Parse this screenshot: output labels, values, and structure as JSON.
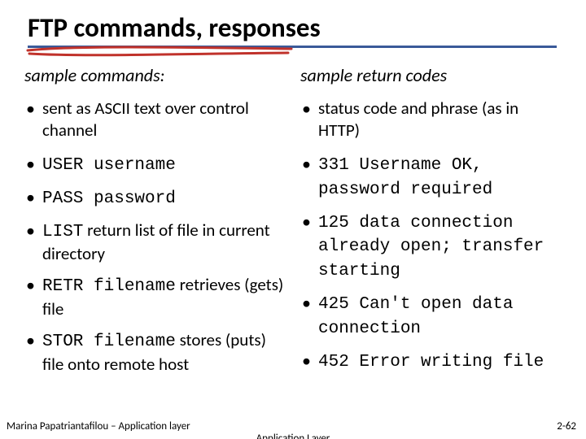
{
  "title": "FTP commands, responses",
  "left": {
    "heading": "sample commands:",
    "items": [
      {
        "plain_pre": "sent as ASCII text over control channel",
        "mono": "",
        "plain_post": ""
      },
      {
        "plain_pre": "",
        "mono": "USER username",
        "plain_post": ""
      },
      {
        "plain_pre": "",
        "mono": "PASS password",
        "plain_post": ""
      },
      {
        "plain_pre": "",
        "mono": "LIST",
        "plain_post": " return list of file in current directory"
      },
      {
        "plain_pre": "",
        "mono": "RETR filename",
        "plain_post": " retrieves (gets) file"
      },
      {
        "plain_pre": "",
        "mono": "STOR filename",
        "plain_post": " stores (puts) file onto remote host"
      }
    ]
  },
  "right": {
    "heading": "sample return codes",
    "items": [
      {
        "plain_pre": "status code and phrase (as in HTTP)",
        "mono": "",
        "plain_post": ""
      },
      {
        "plain_pre": "",
        "mono": "331 Username OK, password required",
        "plain_post": ""
      },
      {
        "plain_pre": "",
        "mono": "125 data connection already open; transfer starting",
        "plain_post": ""
      },
      {
        "plain_pre": "",
        "mono": "425 Can't open data connection",
        "plain_post": ""
      },
      {
        "plain_pre": "",
        "mono": "452 Error writing file",
        "plain_post": ""
      }
    ]
  },
  "footer": {
    "left": "Marina Papatriantafilou – Application layer",
    "center": "Application Layer",
    "right": "2-62"
  }
}
